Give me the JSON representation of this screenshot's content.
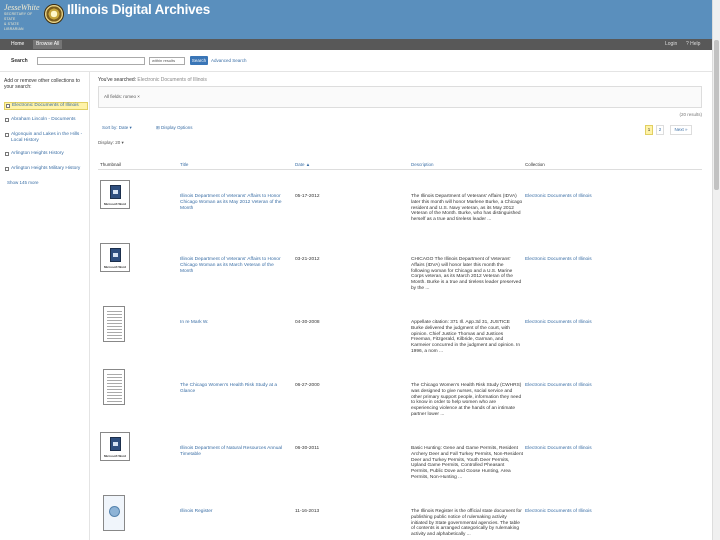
{
  "header": {
    "logo_line1": "JesseWhite",
    "logo_line2": "SECRETARY OF STATE",
    "logo_line3": "& STATE LIBRARIAN",
    "site_title": "Illinois Digital Archives",
    "brand_color": "#5a8fbd"
  },
  "nav": {
    "tabs": [
      "Home",
      "Browse All"
    ],
    "login": "Login",
    "help": "? Help"
  },
  "search": {
    "label": "Search",
    "scope": "within results",
    "button": "Search",
    "advanced": "Advanced Search"
  },
  "sidebar": {
    "heading": "Add or remove other collections to your search:",
    "items": [
      "Electronic Documents of Illinois",
      "Abraham Lincoln - Documents",
      "Algonquin and Lakes in the Hills - Local History",
      "Arlington Heights History",
      "Arlington Heights Military History"
    ],
    "more": "Show 145 more"
  },
  "main": {
    "searched_prefix": "You've searched:",
    "searched_value": "Electronic Documents of Illinois",
    "filter": "All fields: romeo ×",
    "results_count": "(20 results)",
    "sort": "Sort by: Date ▾",
    "display_options": "⊞ Display Options",
    "display": "Display: 20 ▾",
    "pages": [
      "1",
      "2"
    ],
    "next": "Next »",
    "columns": [
      "Thumbnail",
      "Title",
      "Date ▲",
      "Description",
      "Collection"
    ]
  },
  "results": [
    {
      "thumb": "Microsoft Word",
      "title": "Illinois Department of Veterans' Affairs to Honor Chicago Woman as its May 2012 Veteran of the Month",
      "date": "05-17-2012",
      "desc": "The Illinois Department of Veterans' Affairs (IDVA) later this month will honor Marlene Burke, a Chicago resident and U.S. Navy veteran, as its May 2012 Veteran of the Month. Burke, who has distinguished herself as a true and tireless leader ...",
      "collection": "Electronic Documents of Illinois"
    },
    {
      "thumb": "Microsoft Word",
      "title": "Illinois Department of Veterans' Affairs to Honor Chicago Woman as its March Veteran of the Month",
      "date": "03-21-2012",
      "desc": "CHICAGO The Illinois Department of Veterans' Affairs (IDVA) will honor later this month the following woman for Chicago and a U.S. Marine Corps veteran, as its March 2012 Veteran of the Month. Burke is a true and tireless leader preserved by the ...",
      "collection": "Electronic Documents of Illinois"
    },
    {
      "thumb": "",
      "title": "In re Mark W.",
      "date": "04-30-2008",
      "desc": "Appellate citation: 371 Ill. App.3d 31, JUSTICE Burke delivered the judgment of the court, with opinion. Chief Justice Thomas and Justices Freeman, Fitzgerald, Kilbride, Garman, and Karmeier concurred in the judgment and opinion. In 1996, a nom ...",
      "collection": "Electronic Documents of Illinois"
    },
    {
      "thumb": "",
      "title": "The Chicago Women's Health Risk Study at a Glance",
      "date": "06-27-2000",
      "desc": "The Chicago Women's Health Risk Study (CWHRS) was designed to give nurses, social service and other primary support people, information they need to know in order to help women who are experiencing violence at the hands of an intimate partner lower ...",
      "collection": "Electronic Documents of Illinois"
    },
    {
      "thumb": "Microsoft Word",
      "title": "Illinois Department of Natural Resources Annual Timetable",
      "date": "06-30-2011",
      "desc": "Basic Hunting: Gene and Game Permits, Resident Archery Deer and Fall Turkey Permits, Non-Resident Deer and Turkey Permits, Youth Deer Permits, Upland Game Permits, Controlled Pheasant Permits, Public Dove and Goose Hunting, Area Permits, Non-Hunting ...",
      "collection": "Electronic Documents of Illinois"
    },
    {
      "thumb": "",
      "title": "Illinois Register",
      "date": "11-16-2013",
      "desc": "The Illinois Register is the official state document for publishing public notice of rulemaking activity initiated by State governmental agencies. The table of contents is arranged categorically by rulemaking activity and alphabetically ...",
      "collection": "Electronic Documents of Illinois"
    }
  ]
}
